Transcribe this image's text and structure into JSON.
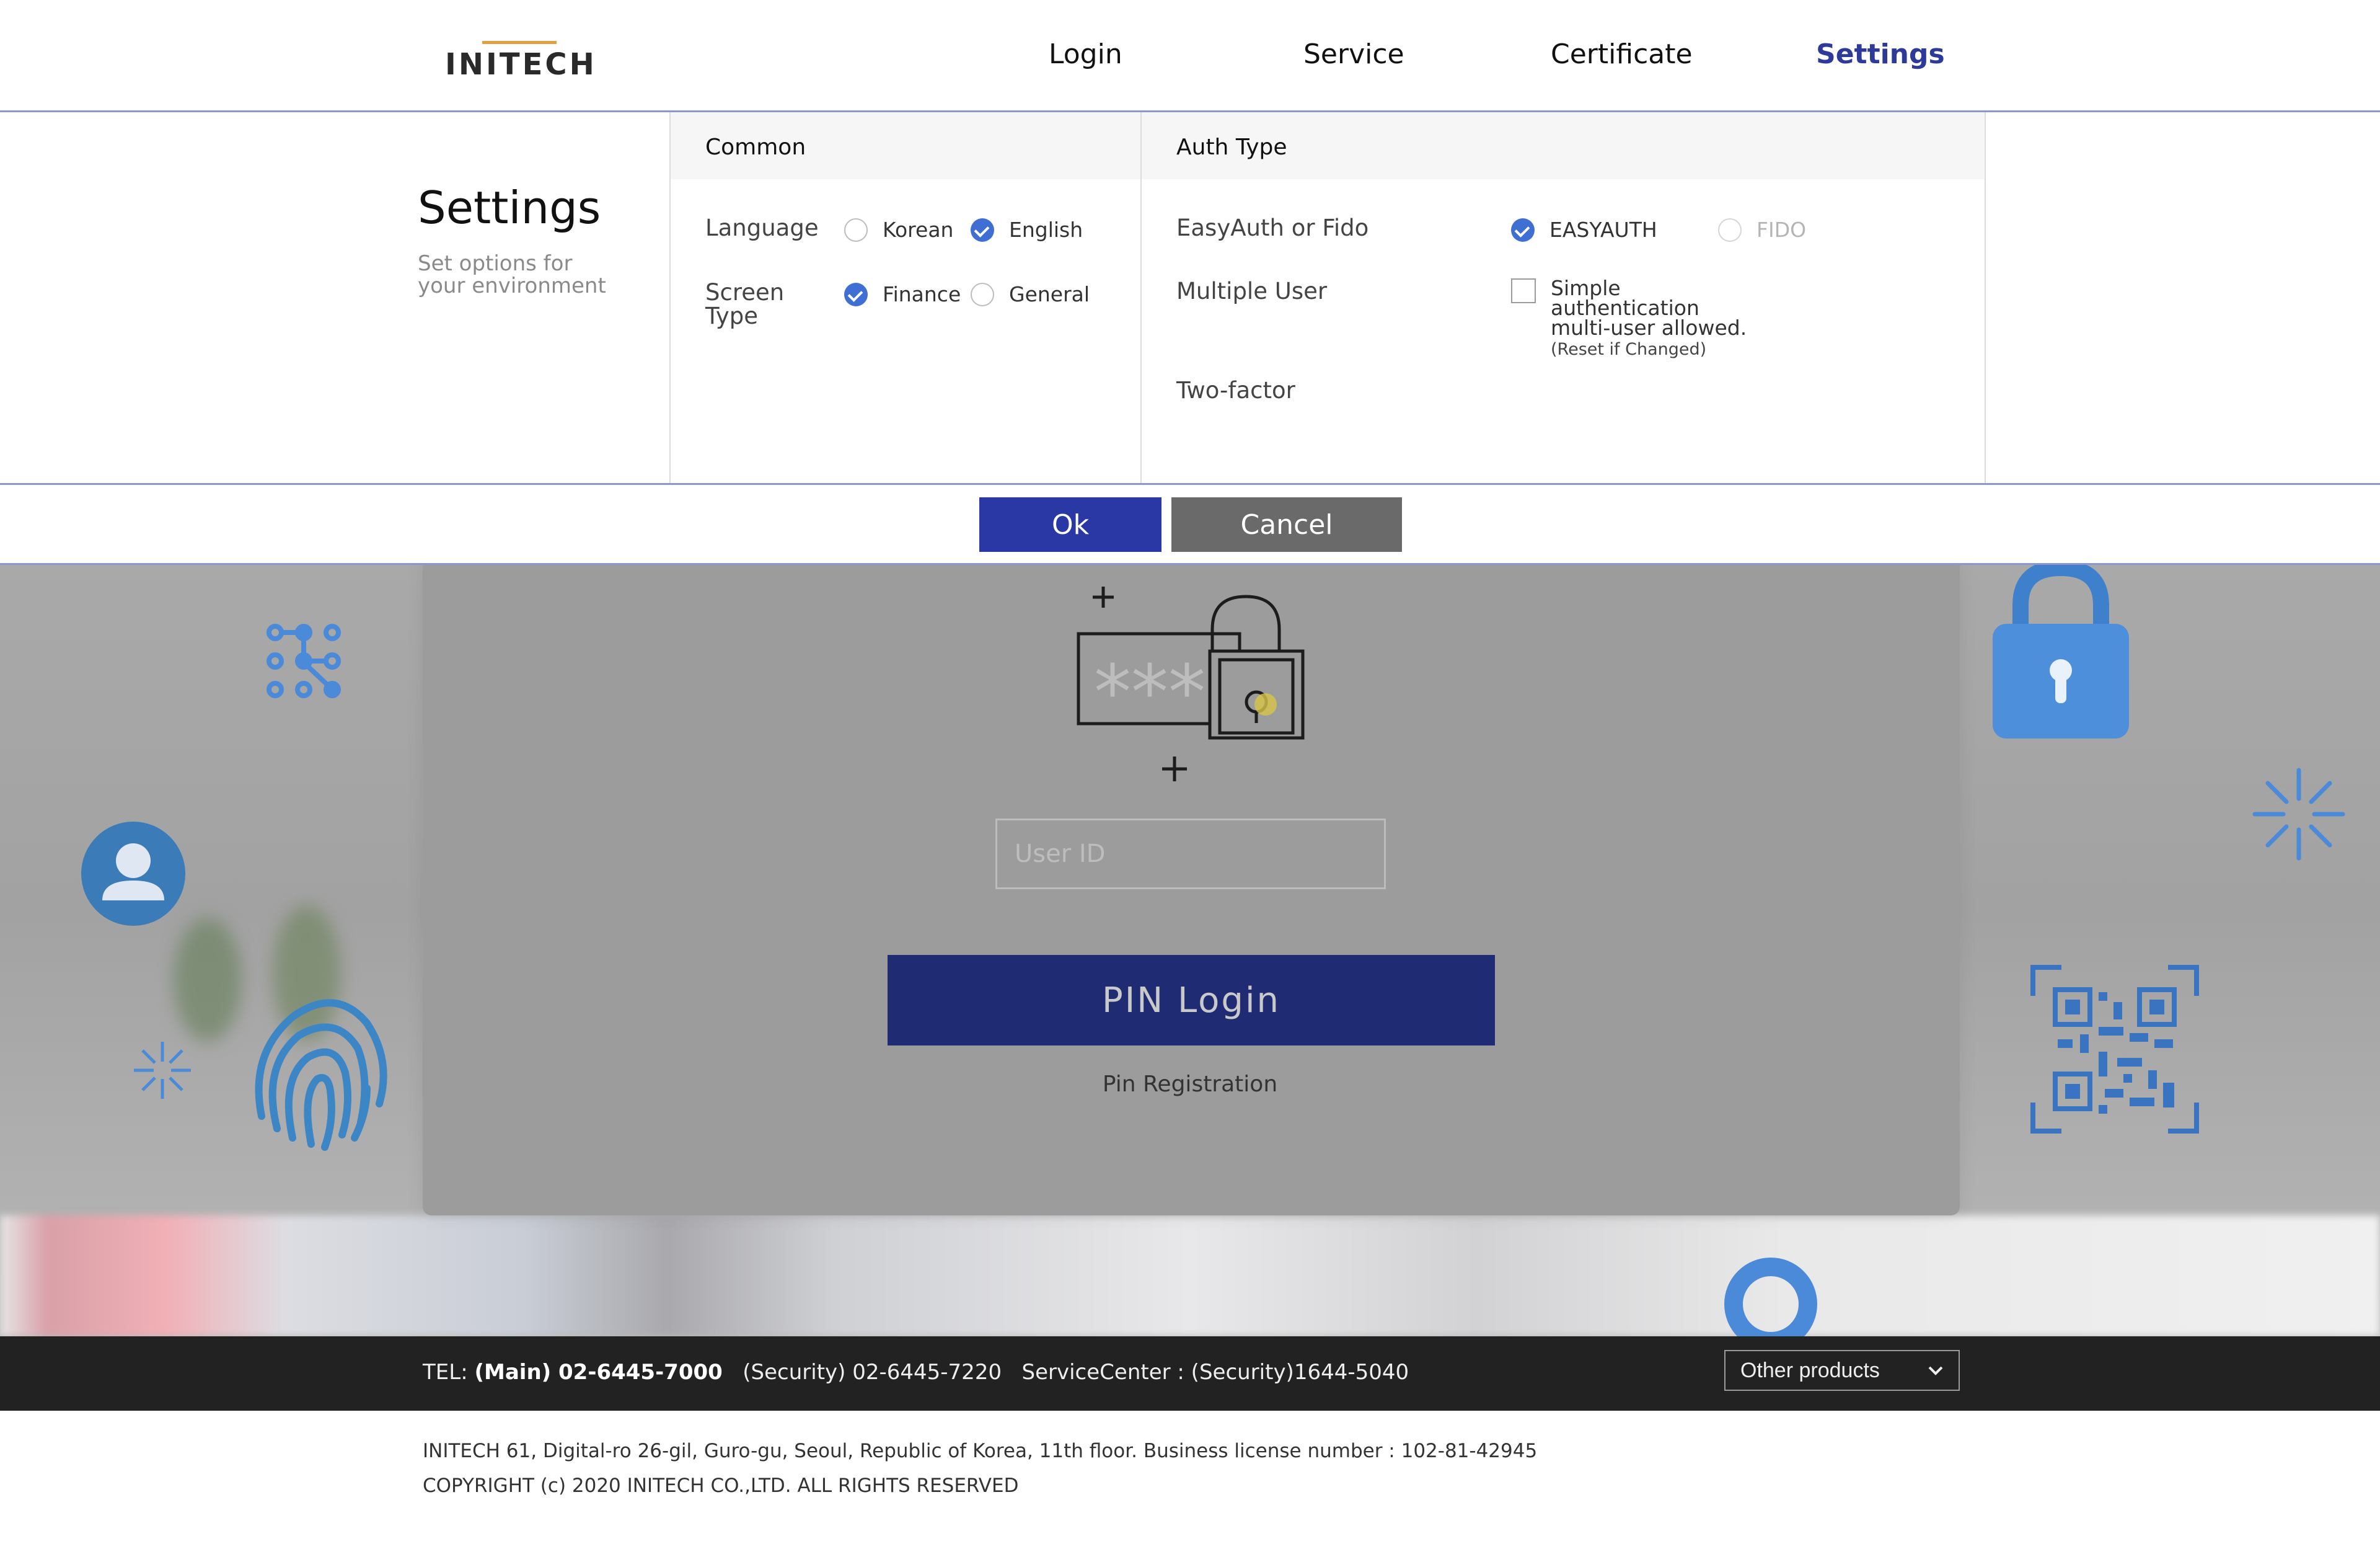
{
  "header": {
    "logo": "INITECH",
    "nav": [
      {
        "label": "Login",
        "active": false
      },
      {
        "label": "Service",
        "active": false
      },
      {
        "label": "Certificate",
        "active": false
      },
      {
        "label": "Settings",
        "active": true
      }
    ]
  },
  "settings": {
    "title": "Settings",
    "subtitle": "Set options for your environment",
    "common": {
      "heading": "Common",
      "language_label": "Language",
      "language_options": [
        {
          "label": "Korean",
          "selected": false
        },
        {
          "label": "English",
          "selected": true
        }
      ],
      "screen_type_label": "Screen Type",
      "screen_type_options": [
        {
          "label": "Finance",
          "selected": true
        },
        {
          "label": "General",
          "selected": false
        }
      ]
    },
    "auth": {
      "heading": "Auth Type",
      "easyauth_label": "EasyAuth or Fido",
      "easyauth_options": [
        {
          "label": "EASYAUTH",
          "selected": true
        },
        {
          "label": "FIDO",
          "selected": false,
          "disabled": true
        }
      ],
      "multi_user_label": "Multiple User",
      "multi_user_checkbox": "Simple authentication multi-user allowed.",
      "multi_user_note": "(Reset if Changed)",
      "multi_user_checked": false,
      "two_factor_label": "Two-factor"
    },
    "ok": "Ok",
    "cancel": "Cancel"
  },
  "login": {
    "userid_placeholder": "User ID",
    "pin_login": "PIN Login",
    "pin_registration": "Pin Registration"
  },
  "footer": {
    "tel_prefix": "TEL: ",
    "tel_main": "(Main) 02-6445-7000",
    "tel_security": "(Security) 02-6445-7220",
    "service_center": "ServiceCenter : (Security)1644-5040",
    "products": "Other products",
    "address": "INITECH 61, Digital-ro 26-gil, Guro-gu, Seoul, Republic of Korea, 11th floor. Business license number : 102-81-42945",
    "copyright": "COPYRIGHT (c) 2020 INITECH CO.,LTD. ALL RIGHTS RESERVED"
  },
  "colors": {
    "accent": "#2d3a9a",
    "ok_button": "#2a38a6",
    "cancel_button": "#6a6a6a",
    "pin_button": "#1f2b73",
    "radio_on": "#3f6fd3",
    "icon_blue": "#4a8ad8"
  }
}
